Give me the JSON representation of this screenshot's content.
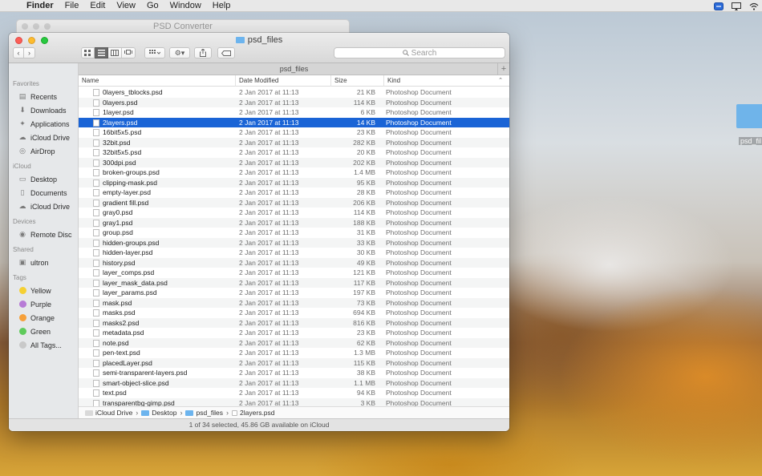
{
  "menubar": {
    "app": "Finder",
    "menus": [
      "File",
      "Edit",
      "View",
      "Go",
      "Window",
      "Help"
    ]
  },
  "background_window": {
    "title": "PSD Converter"
  },
  "window": {
    "title": "psd_files",
    "path_tab": "psd_files",
    "search_placeholder": "Search",
    "view_buttons": [
      "icon-view",
      "list-view",
      "column-view",
      "cover-flow-view"
    ]
  },
  "sidebar": {
    "sections": [
      {
        "title": "Favorites",
        "items": [
          {
            "label": "Recents",
            "icon": "recents-icon"
          },
          {
            "label": "Downloads",
            "icon": "downloads-icon"
          },
          {
            "label": "Applications",
            "icon": "applications-icon"
          },
          {
            "label": "iCloud Drive",
            "icon": "cloud-icon"
          },
          {
            "label": "AirDrop",
            "icon": "airdrop-icon"
          }
        ]
      },
      {
        "title": "iCloud",
        "items": [
          {
            "label": "Desktop",
            "icon": "desktop-icon"
          },
          {
            "label": "Documents",
            "icon": "documents-icon"
          },
          {
            "label": "iCloud Drive",
            "icon": "cloud-icon"
          }
        ]
      },
      {
        "title": "Devices",
        "items": [
          {
            "label": "Remote Disc",
            "icon": "disc-icon"
          }
        ]
      },
      {
        "title": "Shared",
        "items": [
          {
            "label": "ultron",
            "icon": "computer-icon"
          }
        ]
      },
      {
        "title": "Tags",
        "items": [
          {
            "label": "Yellow",
            "color": "#f5d033"
          },
          {
            "label": "Purple",
            "color": "#b77bd6"
          },
          {
            "label": "Orange",
            "color": "#f6a03a"
          },
          {
            "label": "Green",
            "color": "#5fcb5b"
          },
          {
            "label": "All Tags...",
            "color": "#c9c9c9"
          }
        ]
      }
    ]
  },
  "columns": {
    "name": "Name",
    "date": "Date Modified",
    "size": "Size",
    "kind": "Kind"
  },
  "files": [
    {
      "name": "0layers_tblocks.psd",
      "date": "2 Jan 2017 at 11:13",
      "size": "21 KB",
      "kind": "Photoshop Document"
    },
    {
      "name": "0layers.psd",
      "date": "2 Jan 2017 at 11:13",
      "size": "114 KB",
      "kind": "Photoshop Document"
    },
    {
      "name": "1layer.psd",
      "date": "2 Jan 2017 at 11:13",
      "size": "6 KB",
      "kind": "Photoshop Document"
    },
    {
      "name": "2layers.psd",
      "date": "2 Jan 2017 at 11:13",
      "size": "14 KB",
      "kind": "Photoshop Document",
      "selected": true
    },
    {
      "name": "16bit5x5.psd",
      "date": "2 Jan 2017 at 11:13",
      "size": "23 KB",
      "kind": "Photoshop Document"
    },
    {
      "name": "32bit.psd",
      "date": "2 Jan 2017 at 11:13",
      "size": "282 KB",
      "kind": "Photoshop Document"
    },
    {
      "name": "32bit5x5.psd",
      "date": "2 Jan 2017 at 11:13",
      "size": "20 KB",
      "kind": "Photoshop Document"
    },
    {
      "name": "300dpi.psd",
      "date": "2 Jan 2017 at 11:13",
      "size": "202 KB",
      "kind": "Photoshop Document"
    },
    {
      "name": "broken-groups.psd",
      "date": "2 Jan 2017 at 11:13",
      "size": "1.4 MB",
      "kind": "Photoshop Document"
    },
    {
      "name": "clipping-mask.psd",
      "date": "2 Jan 2017 at 11:13",
      "size": "95 KB",
      "kind": "Photoshop Document"
    },
    {
      "name": "empty-layer.psd",
      "date": "2 Jan 2017 at 11:13",
      "size": "28 KB",
      "kind": "Photoshop Document"
    },
    {
      "name": "gradient fill.psd",
      "date": "2 Jan 2017 at 11:13",
      "size": "206 KB",
      "kind": "Photoshop Document"
    },
    {
      "name": "gray0.psd",
      "date": "2 Jan 2017 at 11:13",
      "size": "114 KB",
      "kind": "Photoshop Document"
    },
    {
      "name": "gray1.psd",
      "date": "2 Jan 2017 at 11:13",
      "size": "188 KB",
      "kind": "Photoshop Document"
    },
    {
      "name": "group.psd",
      "date": "2 Jan 2017 at 11:13",
      "size": "31 KB",
      "kind": "Photoshop Document"
    },
    {
      "name": "hidden-groups.psd",
      "date": "2 Jan 2017 at 11:13",
      "size": "33 KB",
      "kind": "Photoshop Document"
    },
    {
      "name": "hidden-layer.psd",
      "date": "2 Jan 2017 at 11:13",
      "size": "30 KB",
      "kind": "Photoshop Document"
    },
    {
      "name": "history.psd",
      "date": "2 Jan 2017 at 11:13",
      "size": "49 KB",
      "kind": "Photoshop Document"
    },
    {
      "name": "layer_comps.psd",
      "date": "2 Jan 2017 at 11:13",
      "size": "121 KB",
      "kind": "Photoshop Document"
    },
    {
      "name": "layer_mask_data.psd",
      "date": "2 Jan 2017 at 11:13",
      "size": "117 KB",
      "kind": "Photoshop Document"
    },
    {
      "name": "layer_params.psd",
      "date": "2 Jan 2017 at 11:13",
      "size": "197 KB",
      "kind": "Photoshop Document"
    },
    {
      "name": "mask.psd",
      "date": "2 Jan 2017 at 11:13",
      "size": "73 KB",
      "kind": "Photoshop Document"
    },
    {
      "name": "masks.psd",
      "date": "2 Jan 2017 at 11:13",
      "size": "694 KB",
      "kind": "Photoshop Document"
    },
    {
      "name": "masks2.psd",
      "date": "2 Jan 2017 at 11:13",
      "size": "816 KB",
      "kind": "Photoshop Document"
    },
    {
      "name": "metadata.psd",
      "date": "2 Jan 2017 at 11:13",
      "size": "23 KB",
      "kind": "Photoshop Document"
    },
    {
      "name": "note.psd",
      "date": "2 Jan 2017 at 11:13",
      "size": "62 KB",
      "kind": "Photoshop Document"
    },
    {
      "name": "pen-text.psd",
      "date": "2 Jan 2017 at 11:13",
      "size": "1.3 MB",
      "kind": "Photoshop Document"
    },
    {
      "name": "placedLayer.psd",
      "date": "2 Jan 2017 at 11:13",
      "size": "115 KB",
      "kind": "Photoshop Document"
    },
    {
      "name": "semi-transparent-layers.psd",
      "date": "2 Jan 2017 at 11:13",
      "size": "38 KB",
      "kind": "Photoshop Document"
    },
    {
      "name": "smart-object-slice.psd",
      "date": "2 Jan 2017 at 11:13",
      "size": "1.1 MB",
      "kind": "Photoshop Document"
    },
    {
      "name": "text.psd",
      "date": "2 Jan 2017 at 11:13",
      "size": "94 KB",
      "kind": "Photoshop Document"
    },
    {
      "name": "transparentbg-gimp.psd",
      "date": "2 Jan 2017 at 11:13",
      "size": "3 KB",
      "kind": "Photoshop Document"
    }
  ],
  "breadcrumbs": [
    "iCloud Drive",
    "Desktop",
    "psd_files",
    "2layers.psd"
  ],
  "status": "1 of 34 selected, 45.86 GB available on iCloud",
  "desktop": {
    "folder_label": "psd_fil"
  },
  "colors": {
    "selection": "#1a64d6",
    "folder": "#6cb4ee"
  }
}
